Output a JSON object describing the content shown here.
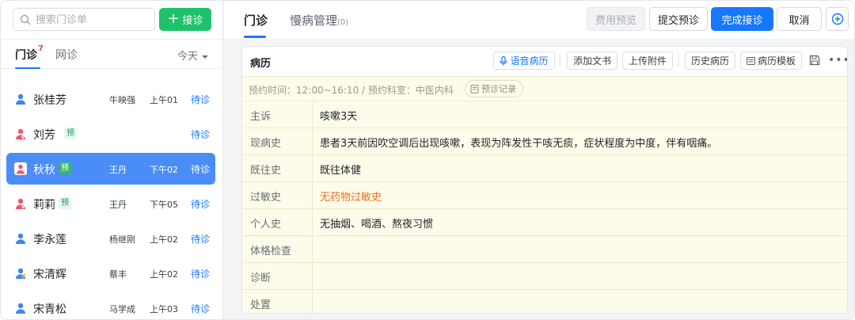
{
  "search": {
    "placeholder": "搜索门诊单"
  },
  "add_button": {
    "label": "接诊"
  },
  "left_tabs": {
    "outpatient": {
      "label": "门诊",
      "badge": "7"
    },
    "online": {
      "label": "网诊"
    },
    "date_filter": "今天"
  },
  "patients": [
    {
      "name": "张桂芳",
      "tag": "",
      "doctor": "牛映强",
      "time": "上午01",
      "status": "待诊",
      "gender": "male"
    },
    {
      "name": "刘芳",
      "tag": "预",
      "doctor": "",
      "time": "",
      "status": "待诊",
      "gender": "female"
    },
    {
      "name": "秋秋",
      "tag": "预",
      "doctor": "王丹",
      "time": "下午02",
      "status": "待诊",
      "gender": "female"
    },
    {
      "name": "莉莉",
      "tag": "预",
      "doctor": "王丹",
      "time": "下午05",
      "status": "待诊",
      "gender": "female"
    },
    {
      "name": "李永莲",
      "tag": "",
      "doctor": "杨继刚",
      "time": "上午02",
      "status": "待诊",
      "gender": "male"
    },
    {
      "name": "宋清辉",
      "tag": "",
      "doctor": "蔡丰",
      "time": "上午02",
      "status": "待诊",
      "gender": "female"
    },
    {
      "name": "宋青松",
      "tag": "",
      "doctor": "马学成",
      "time": "上午03",
      "status": "待诊",
      "gender": "male"
    }
  ],
  "header": {
    "tab_outpatient": "门诊",
    "tab_chronic": "慢病管理",
    "tab_chronic_count": "(0)",
    "btn_fee_preview": "费用预览",
    "btn_submit_prediag": "提交预诊",
    "btn_complete": "完成接诊",
    "btn_cancel": "取消"
  },
  "record": {
    "title": "病历",
    "toolbar": {
      "voice": "语音病历",
      "add_doc": "添加文书",
      "upload": "上传附件",
      "history": "历史病历",
      "template": "病历模板"
    },
    "appointment": {
      "text": "预约时间：12:00~16:10 / 预约科室：中医内科",
      "record_button": "预诊记录"
    },
    "fields": [
      {
        "label": "主诉",
        "value": "咳嗽3天"
      },
      {
        "label": "现病史",
        "value": "患者3天前因吹空调后出现咳嗽，表现为阵发性干咳无痰，症状程度为中度，伴有咽痛。"
      },
      {
        "label": "既往史",
        "value": "既往体健"
      },
      {
        "label": "过敏史",
        "value": "无药物过敏史"
      },
      {
        "label": "个人史",
        "value": "无抽烟、喝酒、熬夜习惯"
      },
      {
        "label": "体格检查",
        "value": ""
      },
      {
        "label": "诊断",
        "value": ""
      },
      {
        "label": "处置",
        "value": ""
      }
    ]
  },
  "colors": {
    "primary": "#1677ff",
    "green": "#1fc26b",
    "selected_row": "#4a8df7",
    "allergy_warn": "#f4701f",
    "record_bg": "#fdfbe9"
  }
}
